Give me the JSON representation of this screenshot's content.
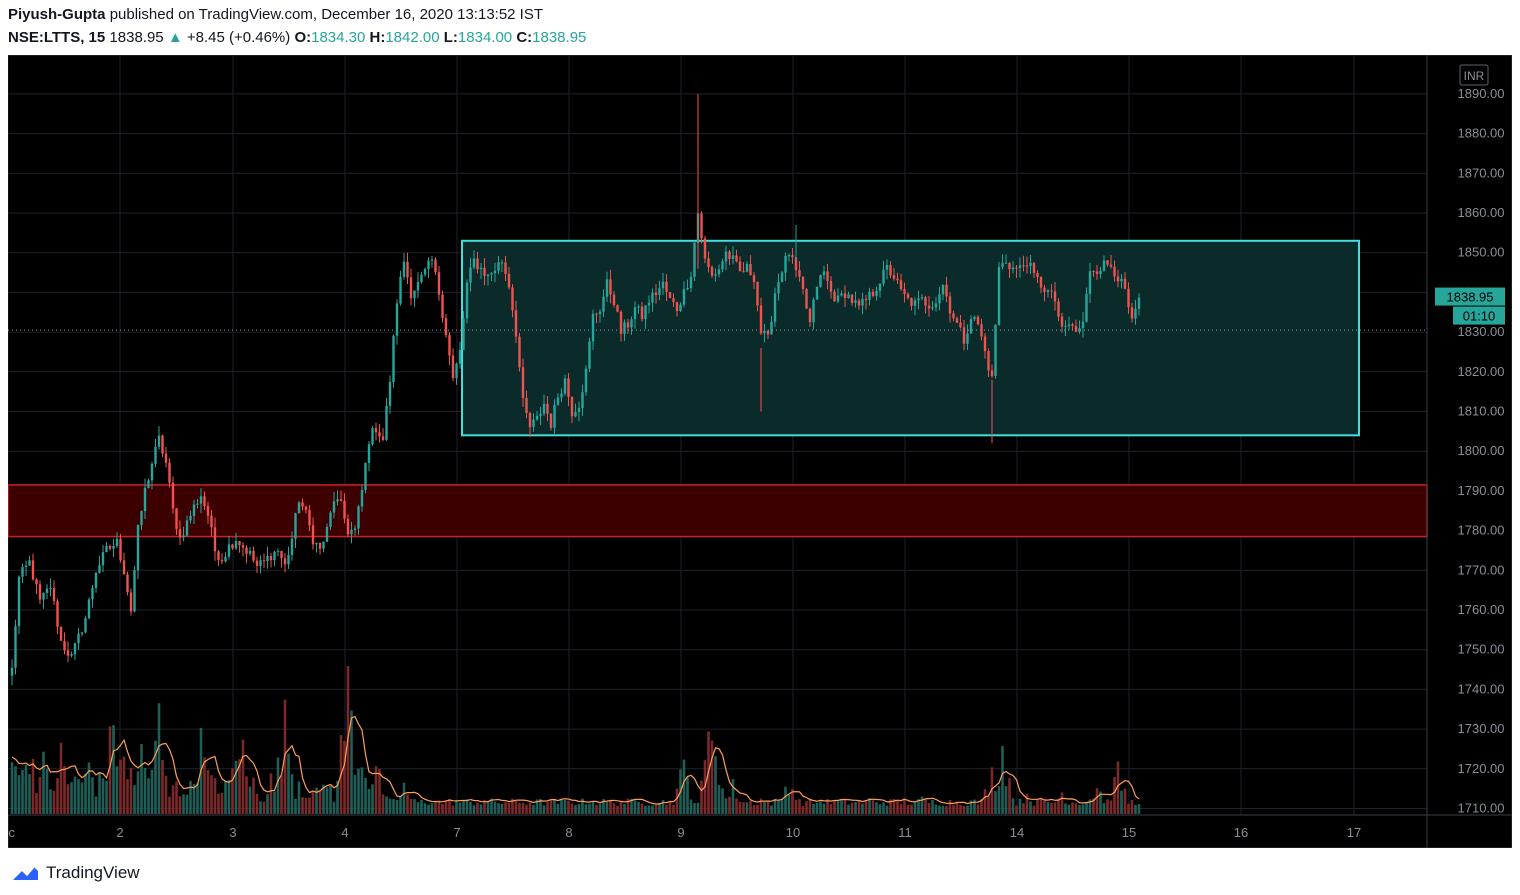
{
  "header": {
    "author": "Piyush-Gupta",
    "published_text": "published on TradingView.com, December 16, 2020 13:13:52 IST",
    "symbol": "NSE:LTTS, 15",
    "last": "1838.95",
    "change": "+8.45 (+0.46%)",
    "open_label": "O:",
    "open": "1834.30",
    "high_label": "H:",
    "high": "1842.00",
    "low_label": "L:",
    "low": "1834.00",
    "close_label": "C:",
    "close": "1838.95"
  },
  "footer": {
    "brand": "TradingView"
  },
  "colors": {
    "up": "#26a69a",
    "down": "#ef5350",
    "box_border": "#40e0e0",
    "box_fill": "#0b2a2a",
    "zone_border": "#cc2222",
    "zone_fill": "#3d0000",
    "volume_ma": "#ff9e5a",
    "background": "#000000"
  },
  "chart_data": {
    "type": "candlestick",
    "currency": "INR",
    "y_ticks": [
      "1890.00",
      "1880.00",
      "1870.00",
      "1860.00",
      "1850.00",
      "1840.00",
      "1830.00",
      "1820.00",
      "1810.00",
      "1800.00",
      "1790.00",
      "1780.00",
      "1770.00",
      "1760.00",
      "1750.00",
      "1740.00",
      "1730.00",
      "1720.00",
      "1710.00"
    ],
    "ylim": [
      1707,
      1898
    ],
    "x_ticks": [
      "ec",
      "2",
      "3",
      "4",
      "7",
      "8",
      "9",
      "10",
      "11",
      "14",
      "15",
      "16",
      "17"
    ],
    "last_price_label": "1838.95",
    "countdown_label": "01:10",
    "dotted_price_line": 1830.5,
    "range_box": {
      "from_day": "7",
      "to_day": "17",
      "top": 1853,
      "bottom": 1804
    },
    "demand_zone": {
      "top": 1791.5,
      "bottom": 1778.5
    },
    "anchors": [
      [
        0,
        1745
      ],
      [
        2,
        1768
      ],
      [
        5,
        1772
      ],
      [
        8,
        1762
      ],
      [
        11,
        1766
      ],
      [
        14,
        1752
      ],
      [
        17,
        1748
      ],
      [
        21,
        1758
      ],
      [
        24,
        1770
      ],
      [
        27,
        1775
      ],
      [
        30,
        1777
      ],
      [
        32,
        1770
      ],
      [
        34,
        1760
      ],
      [
        36,
        1780
      ],
      [
        38,
        1790
      ],
      [
        40,
        1797
      ],
      [
        42,
        1803
      ],
      [
        44,
        1797
      ],
      [
        46,
        1785
      ],
      [
        48,
        1778
      ],
      [
        50,
        1782
      ],
      [
        52,
        1786
      ],
      [
        54,
        1789
      ],
      [
        56,
        1784
      ],
      [
        58,
        1775
      ],
      [
        60,
        1773
      ],
      [
        62,
        1776
      ],
      [
        64,
        1778
      ],
      [
        66,
        1776
      ],
      [
        68,
        1774
      ],
      [
        70,
        1771
      ],
      [
        72,
        1772
      ],
      [
        74,
        1774
      ],
      [
        76,
        1775
      ],
      [
        78,
        1771
      ],
      [
        80,
        1778
      ],
      [
        82,
        1788
      ],
      [
        84,
        1784
      ],
      [
        86,
        1778
      ],
      [
        88,
        1775
      ],
      [
        90,
        1780
      ],
      [
        92,
        1788
      ],
      [
        94,
        1786
      ],
      [
        96,
        1780
      ],
      [
        98,
        1780
      ],
      [
        100,
        1790
      ],
      [
        102,
        1803
      ],
      [
        104,
        1806
      ],
      [
        106,
        1803
      ],
      [
        108,
        1818
      ],
      [
        110,
        1838
      ],
      [
        112,
        1848
      ],
      [
        114,
        1840
      ],
      [
        116,
        1842
      ],
      [
        118,
        1845
      ],
      [
        120,
        1848
      ],
      [
        122,
        1840
      ],
      [
        124,
        1830
      ],
      [
        126,
        1818
      ],
      [
        128,
        1825
      ],
      [
        130,
        1842
      ],
      [
        132,
        1848
      ],
      [
        134,
        1846
      ],
      [
        136,
        1844
      ],
      [
        138,
        1846
      ],
      [
        140,
        1848
      ],
      [
        142,
        1842
      ],
      [
        144,
        1830
      ],
      [
        146,
        1812
      ],
      [
        148,
        1806
      ],
      [
        150,
        1808
      ],
      [
        152,
        1812
      ],
      [
        154,
        1807
      ],
      [
        156,
        1814
      ],
      [
        158,
        1818
      ],
      [
        160,
        1810
      ],
      [
        162,
        1812
      ],
      [
        164,
        1820
      ],
      [
        166,
        1834
      ],
      [
        168,
        1836
      ],
      [
        170,
        1842
      ],
      [
        172,
        1838
      ],
      [
        174,
        1830
      ],
      [
        176,
        1832
      ],
      [
        178,
        1836
      ],
      [
        180,
        1834
      ],
      [
        182,
        1838
      ],
      [
        184,
        1840
      ],
      [
        186,
        1842
      ],
      [
        188,
        1838
      ],
      [
        190,
        1836
      ],
      [
        192,
        1840
      ],
      [
        194,
        1845
      ],
      [
        196,
        1860
      ],
      [
        198,
        1848
      ],
      [
        200,
        1844
      ],
      [
        202,
        1846
      ],
      [
        204,
        1850
      ],
      [
        206,
        1848
      ],
      [
        208,
        1845
      ],
      [
        210,
        1846
      ],
      [
        212,
        1844
      ],
      [
        214,
        1830
      ],
      [
        216,
        1828
      ],
      [
        218,
        1840
      ],
      [
        220,
        1846
      ],
      [
        222,
        1850
      ],
      [
        224,
        1845
      ],
      [
        226,
        1840
      ],
      [
        228,
        1832
      ],
      [
        230,
        1842
      ],
      [
        232,
        1845
      ],
      [
        234,
        1840
      ],
      [
        236,
        1838
      ],
      [
        238,
        1840
      ],
      [
        240,
        1838
      ],
      [
        242,
        1836
      ],
      [
        244,
        1838
      ],
      [
        246,
        1840
      ],
      [
        248,
        1843
      ],
      [
        250,
        1846
      ],
      [
        252,
        1844
      ],
      [
        254,
        1840
      ],
      [
        256,
        1838
      ],
      [
        258,
        1837
      ],
      [
        260,
        1838
      ],
      [
        262,
        1837
      ],
      [
        264,
        1838
      ],
      [
        266,
        1842
      ],
      [
        268,
        1836
      ],
      [
        270,
        1832
      ],
      [
        272,
        1828
      ],
      [
        274,
        1834
      ],
      [
        276,
        1832
      ],
      [
        278,
        1825
      ],
      [
        280,
        1818
      ],
      [
        282,
        1846
      ],
      [
        284,
        1848
      ],
      [
        286,
        1846
      ],
      [
        288,
        1846
      ],
      [
        290,
        1848
      ],
      [
        292,
        1844
      ],
      [
        294,
        1842
      ],
      [
        296,
        1840
      ],
      [
        298,
        1838
      ],
      [
        300,
        1830
      ],
      [
        302,
        1832
      ],
      [
        304,
        1830
      ],
      [
        306,
        1832
      ],
      [
        308,
        1846
      ],
      [
        310,
        1846
      ],
      [
        312,
        1847
      ],
      [
        314,
        1847
      ],
      [
        316,
        1844
      ],
      [
        318,
        1840
      ],
      [
        320,
        1832
      ],
      [
        322,
        1838
      ]
    ],
    "volume_peaks": [
      [
        0,
        28
      ],
      [
        5,
        22
      ],
      [
        9,
        15
      ],
      [
        14,
        18
      ],
      [
        18,
        13
      ],
      [
        22,
        16
      ],
      [
        26,
        13
      ],
      [
        29,
        28
      ],
      [
        31,
        20
      ],
      [
        34,
        14
      ],
      [
        37,
        18
      ],
      [
        42,
        30
      ],
      [
        46,
        10
      ],
      [
        50,
        10
      ],
      [
        54,
        22
      ],
      [
        58,
        12
      ],
      [
        62,
        10
      ],
      [
        65,
        25
      ],
      [
        69,
        10
      ],
      [
        74,
        10
      ],
      [
        78,
        28
      ],
      [
        82,
        10
      ],
      [
        86,
        10
      ],
      [
        90,
        10
      ],
      [
        96,
        40
      ],
      [
        100,
        20
      ],
      [
        104,
        14
      ],
      [
        112,
        8
      ],
      [
        120,
        4
      ],
      [
        135,
        4
      ],
      [
        150,
        3
      ],
      [
        165,
        4
      ],
      [
        180,
        4
      ],
      [
        192,
        14
      ],
      [
        200,
        30
      ],
      [
        206,
        8
      ],
      [
        214,
        4
      ],
      [
        222,
        10
      ],
      [
        232,
        4
      ],
      [
        245,
        4
      ],
      [
        260,
        4
      ],
      [
        275,
        3
      ],
      [
        280,
        12
      ],
      [
        283,
        20
      ],
      [
        290,
        6
      ],
      [
        300,
        6
      ],
      [
        310,
        8
      ],
      [
        316,
        12
      ],
      [
        322,
        4
      ]
    ]
  }
}
